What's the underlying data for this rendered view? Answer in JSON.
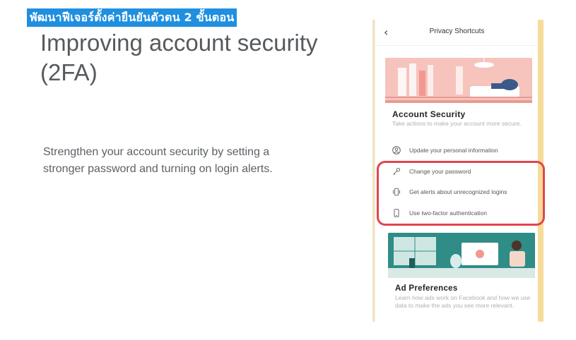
{
  "banner": {
    "text": "พัฒนาฟีเจอร์ตั้งค่ายืนยันตัวตน 2 ขั้นตอน"
  },
  "slide": {
    "title": "Improving account security (2FA)",
    "body": "Strengthen your account security by setting a stronger password and turning on login alerts."
  },
  "phone": {
    "header": {
      "back_icon": "chevron-left-icon",
      "title": "Privacy Shortcuts"
    },
    "account_security": {
      "title": "Account Security",
      "subtitle": "Take actions to make your account more secure.",
      "items": [
        {
          "icon": "person-circle-icon",
          "label": "Update your personal information"
        },
        {
          "icon": "key-icon",
          "label": "Change your password"
        },
        {
          "icon": "vibrating-phone-icon",
          "label": "Get alerts about unrecognized logins"
        },
        {
          "icon": "phone-icon",
          "label": "Use two-factor authentication"
        }
      ]
    },
    "ad_preferences": {
      "title": "Ad Preferences",
      "subtitle": "Learn how ads work on Facebook and how we use data to make the ads you see more relevant."
    },
    "colors": {
      "highlight": "#e2444f",
      "illustration_pink": "#f5b9b3",
      "illustration_teal": "#2f8c86"
    }
  }
}
